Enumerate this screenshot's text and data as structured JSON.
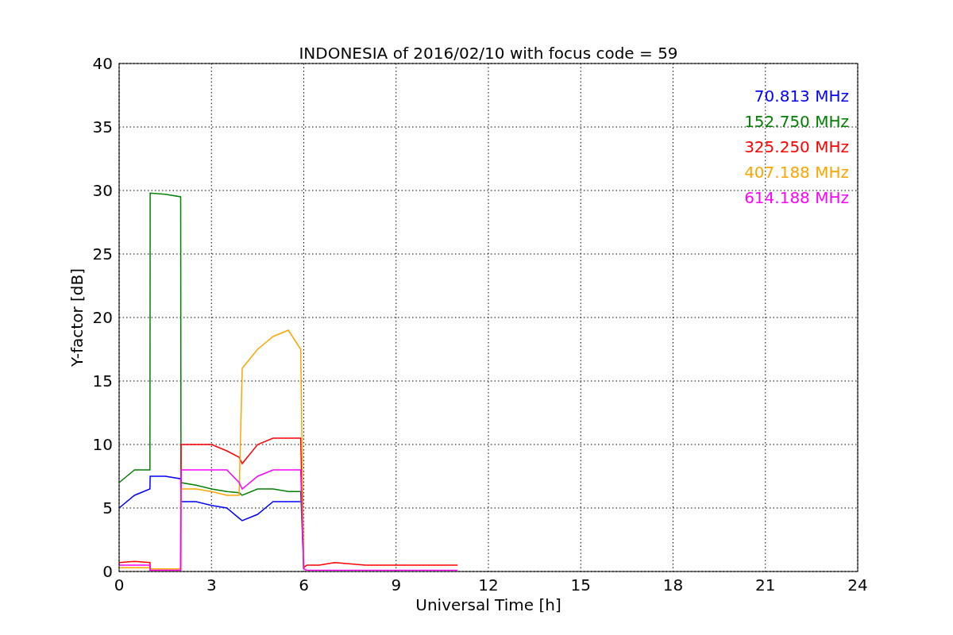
{
  "figure": {
    "chart_data": {
      "type": "line",
      "title": "INDONESIA of 2016/02/10 with focus code = 59",
      "xlabel": "Universal Time [h]",
      "ylabel": "Y-factor [dB]",
      "grid": true,
      "x": [
        0,
        0.5,
        1,
        1.01,
        1.5,
        2,
        2.01,
        2.5,
        3,
        3.5,
        3.9,
        4,
        4.5,
        5,
        5.5,
        5.9,
        6,
        6.1,
        6.5,
        7,
        8,
        9,
        10,
        11
      ],
      "xlim": [
        0,
        24
      ],
      "ylim": [
        0,
        40
      ],
      "xticks": [
        0,
        3,
        6,
        9,
        12,
        15,
        18,
        21,
        24
      ],
      "yticks": [
        0,
        5,
        10,
        15,
        20,
        25,
        30,
        35,
        40
      ],
      "series": [
        {
          "name": "70.813 MHz",
          "color": "#0000ff",
          "values": [
            5,
            6,
            6.5,
            7.5,
            7.5,
            7.3,
            5.5,
            5.5,
            5.2,
            5,
            4.2,
            4,
            4.5,
            5.5,
            5.5,
            5.5,
            null,
            null,
            null,
            null,
            null,
            null,
            null,
            null
          ]
        },
        {
          "name": "152.750 MHz",
          "color": "#008000",
          "values": [
            7,
            8,
            8,
            29.8,
            29.7,
            29.5,
            7,
            6.8,
            6.5,
            6.3,
            6.2,
            6,
            6.5,
            6.5,
            6.3,
            6.3,
            0.2,
            null,
            null,
            null,
            null,
            null,
            null,
            null
          ]
        },
        {
          "name": "325.250 MHz",
          "color": "#ff0000",
          "values": [
            0.7,
            0.8,
            0.7,
            0.1,
            0.1,
            0.1,
            10,
            10,
            10,
            9.5,
            9,
            8.5,
            10,
            10.5,
            10.5,
            10.5,
            0.3,
            0.5,
            0.5,
            0.7,
            0.5,
            0.5,
            0.5,
            0.5
          ]
        },
        {
          "name": "407.188 MHz",
          "color": "#ffa500",
          "values": [
            0.3,
            0.3,
            0.3,
            0.2,
            0.2,
            0.2,
            6.5,
            6.5,
            6.3,
            6,
            6,
            16,
            17.5,
            18.5,
            19,
            17.5,
            0.2,
            null,
            null,
            null,
            null,
            null,
            null,
            null
          ]
        },
        {
          "name": "614.188 MHz",
          "color": "#ff00ff",
          "values": [
            0.5,
            0.5,
            0.5,
            0.1,
            0.1,
            0.1,
            8,
            8,
            8,
            8,
            7,
            6.5,
            7.5,
            8,
            8,
            8,
            0.2,
            0.1,
            0.1,
            0.1,
            0.1,
            0.1,
            0.1,
            0.1
          ]
        }
      ]
    }
  }
}
